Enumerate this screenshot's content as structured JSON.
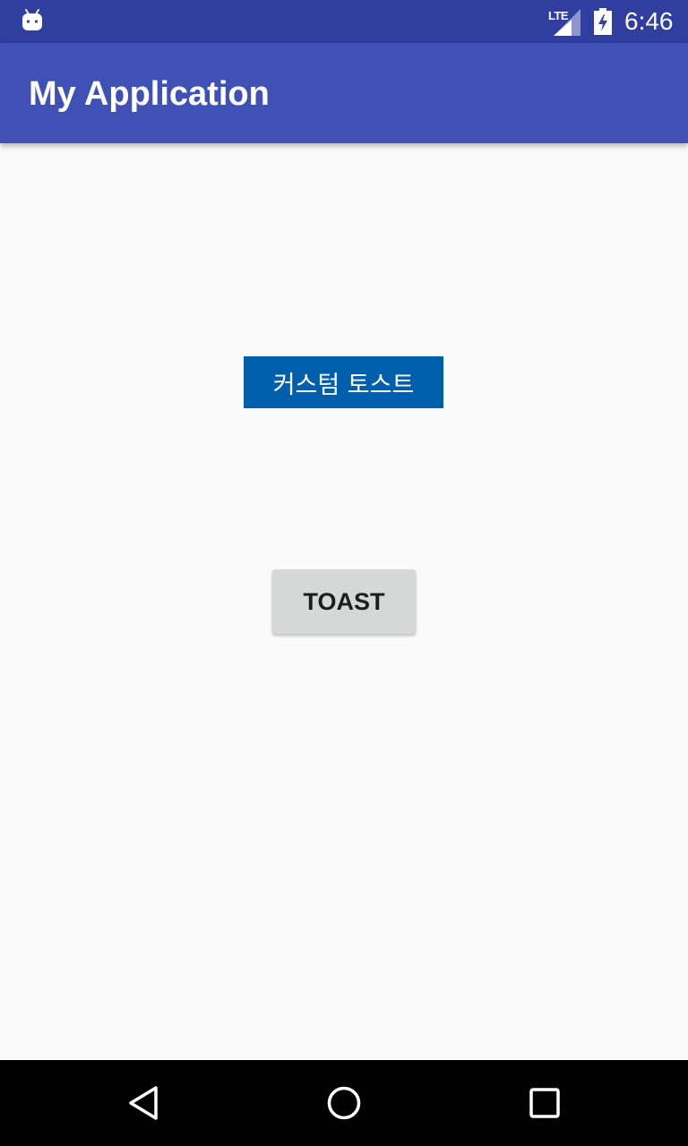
{
  "status_bar": {
    "network_type": "LTE",
    "time": "6:46",
    "icons": [
      "android-debug-icon",
      "signal-icon",
      "battery-charging-icon"
    ]
  },
  "app_bar": {
    "title": "My Application"
  },
  "content": {
    "custom_toast_button_label": "커스텀 토스트",
    "toast_button_label": "TOAST"
  },
  "navigation_bar": {
    "icons": [
      "back-icon",
      "home-icon",
      "recents-icon"
    ]
  },
  "colors": {
    "status_bar": "#303f9f",
    "app_bar": "#3f51b5",
    "custom_button": "#005fad",
    "toast_button": "#d6d7d7",
    "background": "#fafafa"
  }
}
